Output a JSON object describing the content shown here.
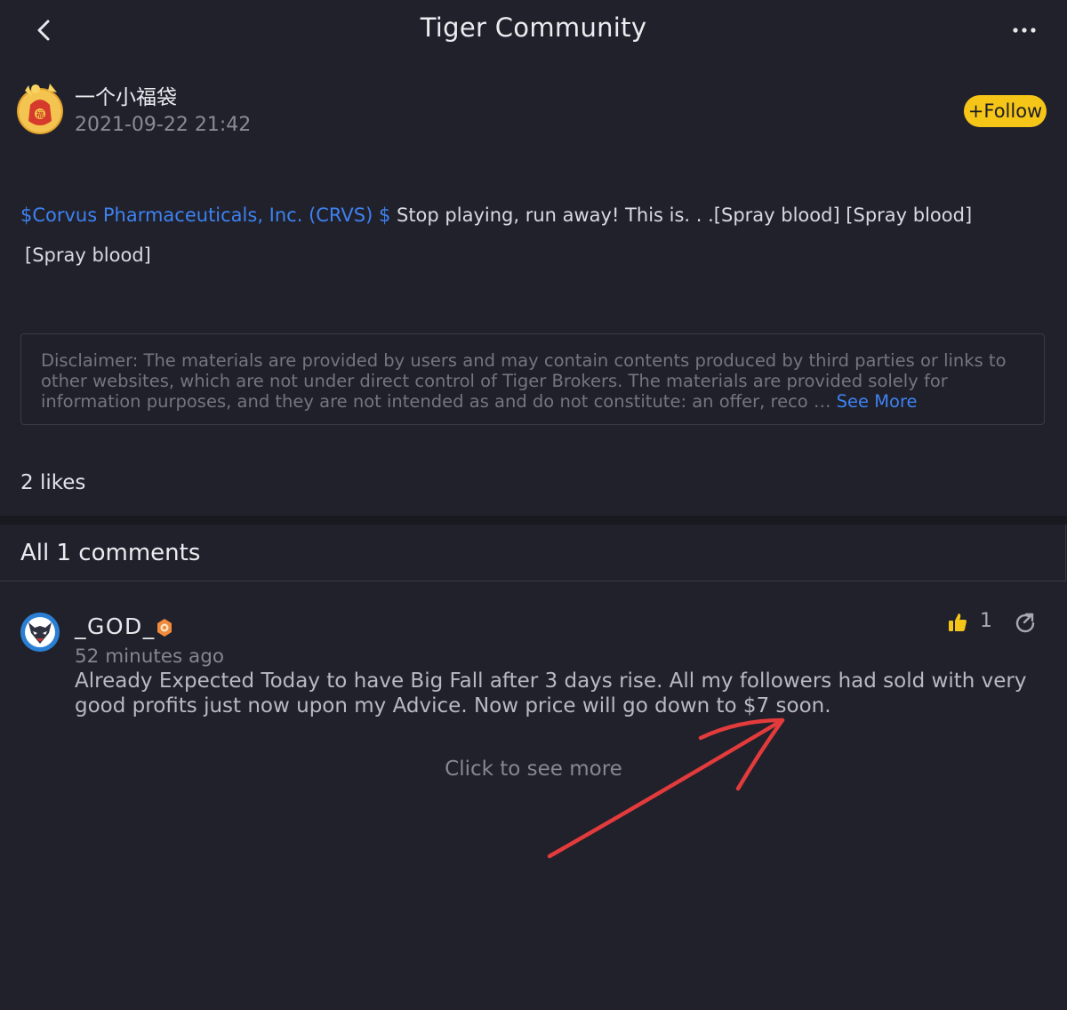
{
  "header": {
    "title": "Tiger Community"
  },
  "post": {
    "author_name": "一个小福袋",
    "timestamp": "2021-09-22 21:42",
    "follow_label": "+Follow",
    "stock_link": "$Corvus Pharmaceuticals, Inc. (CRVS) $",
    "text_line1": " Stop playing, run away! This is. . .[Spray blood]  [Spray blood]",
    "text_line2": "[Spray blood]",
    "disclaimer": "Disclaimer: The materials are provided by users and may contain contents produced by third parties or links to other websites, which are not under direct control of Tiger Brokers. The materials are provided solely for information purposes, and they are not intended as and do not constitute: an offer, reco  … ",
    "see_more_label": "See More",
    "likes": "2 likes"
  },
  "comments": {
    "title": "All 1 comments",
    "items": [
      {
        "user": "_GOD_",
        "time": "52 minutes ago",
        "text": "Already Expected Today to have Big Fall after 3 days rise. All my followers had sold with very good profits just now upon my Advice. Now price will go down to $7 soon.",
        "like_count": "1"
      }
    ],
    "see_more_label": "Click to see more"
  },
  "colors": {
    "background": "#21212c",
    "accent_link": "#3d82f0",
    "follow_button": "#f5c518",
    "annotation_arrow": "#e33b3b"
  },
  "icons": [
    "back-icon",
    "more-icon",
    "avatar-lucky-bag",
    "avatar-wolf",
    "level-badge-icon",
    "thumbs-up-icon",
    "share-icon"
  ]
}
